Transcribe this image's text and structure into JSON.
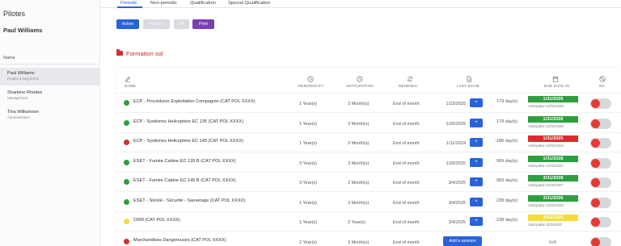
{
  "sidebar": {
    "title": "Pilotes",
    "current_user": "Paul Williams",
    "column_label": "Name",
    "pilots": [
      {
        "name": "Paul Williams",
        "role": "Projets à long terme"
      },
      {
        "name": "Sharlene Rhodes",
        "role": "Management"
      },
      {
        "name": "Tina Williamson",
        "role": "Administration"
      }
    ]
  },
  "tabs": [
    "Periodic",
    "Non-periodic",
    "Qualification",
    "Special Qualification"
  ],
  "filters": {
    "active": "Active",
    "inactive": "Inactive",
    "all": "All",
    "print": "Print"
  },
  "section": {
    "title": "Formation sol"
  },
  "table": {
    "headers": {
      "name": "NAME",
      "periodicity": "PERIODICITY",
      "anticipation": "ANTICIPATION",
      "renewal": "RENEWAL",
      "last_exam": "LAST EXAM",
      "due_date": "DUE DATE IN",
      "nc": "NC"
    },
    "header_icons": {
      "name": "pencil-icon",
      "periodicity": "clock-icon",
      "anticipation": "clock-icon",
      "renewal": "refresh-icon",
      "last_exam": "document-icon",
      "due_date": "calendar-icon",
      "nc": "block-icon"
    },
    "rows": [
      {
        "status": "green",
        "name": "ECP - Procédures Exploitation Compagnie  (CAT POL XXXX)",
        "periodicity": "1 Year(s)",
        "anticipation": "3 Month(s)",
        "renewal": "End of month",
        "last_exam": "1/23/2025",
        "action": "+",
        "days": "179  day(s)",
        "due": "1/31/2026",
        "due_color": "green",
        "anticipation_text": "Anticipation 10/31/2025"
      },
      {
        "status": "green",
        "name": "ECP - Systèmes Helicoptère EC 135  (CAT POL XXXX)",
        "periodicity": "1 Year(s)",
        "anticipation": "3 Month(s)",
        "renewal": "End of month",
        "last_exam": "1/20/2025",
        "action": "+",
        "days": "179  day(s)",
        "due": "1/31/2026",
        "due_color": "green",
        "anticipation_text": "Anticipation 10/31/2025"
      },
      {
        "status": "red",
        "name": "ECP - Systèmes Helicoptère EC 145  (CAT POL XXXX)",
        "periodicity": "1 Year(s)",
        "anticipation": "3 Month(s)",
        "renewal": "End of month",
        "last_exam": "1/11/2024",
        "action": "+",
        "days": "-186  day(s)",
        "due": "1/31/2025",
        "due_color": "red",
        "anticipation_text": "Anticipation 10/31/2024"
      },
      {
        "status": "green",
        "name": "ESET - Fumée Cabine EC 135 B  (CAT POL XXXX)",
        "periodicity": "3 Year(s)",
        "anticipation": "3 Month(s)",
        "renewal": "End of month",
        "last_exam": "1/29/2025",
        "action": "+",
        "days": "909  day(s)",
        "due": "1/31/2028",
        "due_color": "green",
        "anticipation_text": "Anticipation 10/31/2027"
      },
      {
        "status": "green",
        "name": "ESET - Fumée Cabine EC 145 B  (CAT POL XXXX)",
        "periodicity": "3 Year(s)",
        "anticipation": "3 Month(s)",
        "renewal": "End of month",
        "last_exam": "3/4/2025",
        "action": "+",
        "days": "969  day(s)",
        "due": "3/31/2028",
        "due_color": "green",
        "anticipation_text": "Anticipation 12/31/2027"
      },
      {
        "status": "green",
        "name": "ESET - Sûreté - Sécurité - Sauvetage  (CAT POL XXXX)",
        "periodicity": "1 Year(s)",
        "anticipation": "3 Month(s)",
        "renewal": "End of month",
        "last_exam": "3/4/2025",
        "action": "+",
        "days": "238  day(s)",
        "due": "3/31/2026",
        "due_color": "green",
        "anticipation_text": "Anticipation 12/31/2025"
      },
      {
        "status": "yellow",
        "name": "CRM  (CAT POL XXXX)",
        "periodicity": "1 Year(s)",
        "anticipation": "3 Year(s)",
        "renewal": "End of month",
        "last_exam": "3/4/2025",
        "action": "+",
        "days": "238  day(s)",
        "due": "3/31/2026",
        "due_color": "yellow",
        "anticipation_text": "Anticipation 3/31/2023"
      },
      {
        "status": "red",
        "name": "Marchandises Dangereuses  (CAT POL XXXX)",
        "periodicity": "2 Year(s)",
        "anticipation": "3 Month(s)",
        "renewal": "End of month",
        "last_exam": "",
        "action": "Add a session",
        "days": "",
        "due": "N/A",
        "due_color": "none",
        "anticipation_text": ""
      }
    ]
  },
  "colors": {
    "accent": "#2962d9",
    "print": "#7b3fb2",
    "green": "#2e9e3f",
    "red": "#d32f2f",
    "yellow": "#f5dc3a",
    "section_title": "#c62828"
  }
}
